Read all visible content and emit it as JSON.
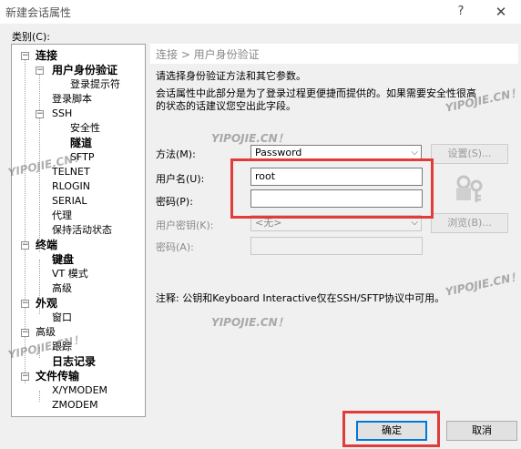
{
  "window": {
    "title": "新建会话属性",
    "help_label": "?",
    "close_label": "✕"
  },
  "tree": {
    "label": "类别(C):",
    "items": [
      {
        "label": "连接"
      },
      {
        "label": "用户身份验证"
      },
      {
        "label": "登录提示符"
      },
      {
        "label": "登录脚本"
      },
      {
        "label": "SSH"
      },
      {
        "label": "安全性"
      },
      {
        "label": "隧道"
      },
      {
        "label": "SFTP"
      },
      {
        "label": "TELNET"
      },
      {
        "label": "RLOGIN"
      },
      {
        "label": "SERIAL"
      },
      {
        "label": "代理"
      },
      {
        "label": "保持活动状态"
      },
      {
        "label": "终端"
      },
      {
        "label": "键盘"
      },
      {
        "label": "VT 模式"
      },
      {
        "label": "高级"
      },
      {
        "label": "外观"
      },
      {
        "label": "窗口"
      },
      {
        "label": "高级"
      },
      {
        "label": "跟踪"
      },
      {
        "label": "日志记录"
      },
      {
        "label": "文件传输"
      },
      {
        "label": "X/YMODEM"
      },
      {
        "label": "ZMODEM"
      }
    ]
  },
  "panel": {
    "breadcrumb": "连接 > 用户身份验证",
    "intro1": "请选择身份验证方法和其它参数。",
    "intro2": "会话属性中此部分是为了登录过程更便捷而提供的。如果需要安全性很高",
    "intro3": "的状态的话建议您空出此字段。",
    "method_label": "方法(M):",
    "method_value": "Password",
    "settings_button": "设置(S)...",
    "username_label": "用户名(U):",
    "username_value": "root",
    "password_label": "密码(P):",
    "password_value": "",
    "userkey_label": "用户密钥(K):",
    "userkey_value": "<无>",
    "browse_button": "浏览(B)...",
    "passphrase_label": "密码(A):",
    "note": "注释: 公钥和Keyboard Interactive仅在SSH/SFTP协议中可用。"
  },
  "footer": {
    "ok_label": "确定",
    "cancel_label": "取消"
  },
  "watermarks": [
    "YIPOJIE.CN！",
    "YIPOJIE.CN！",
    "YIPOJIE.CN！",
    "YIPOJIE.CN！",
    "YIPOJIE.CN！",
    "YIPOJIE.CN！"
  ],
  "icons": {
    "key": "key-lock-icon",
    "expand": "tree-expander-icon"
  }
}
